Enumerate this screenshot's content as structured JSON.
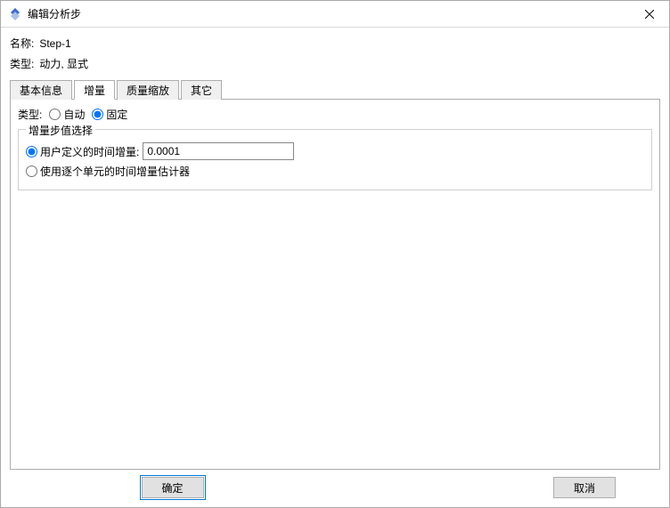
{
  "window": {
    "title": "编辑分析步"
  },
  "info": {
    "name_label": "名称:",
    "name_value": "Step-1",
    "type_label": "类型:",
    "type_value": "动力, 显式"
  },
  "tabs": {
    "basic": "基本信息",
    "increment": "增量",
    "mass_scaling": "质量缩放",
    "other": "其它"
  },
  "increment_tab": {
    "type_label": "类型:",
    "auto_label": "自动",
    "fixed_label": "固定",
    "selected_type": "固定",
    "fieldset_legend": "增量步值选择",
    "user_defined_label": "用户定义的时间增量:",
    "user_defined_value": "0.0001",
    "estimator_label": "使用逐个单元的时间增量估计器",
    "selected_option": "user_defined"
  },
  "buttons": {
    "ok": "确定",
    "cancel": "取消"
  }
}
